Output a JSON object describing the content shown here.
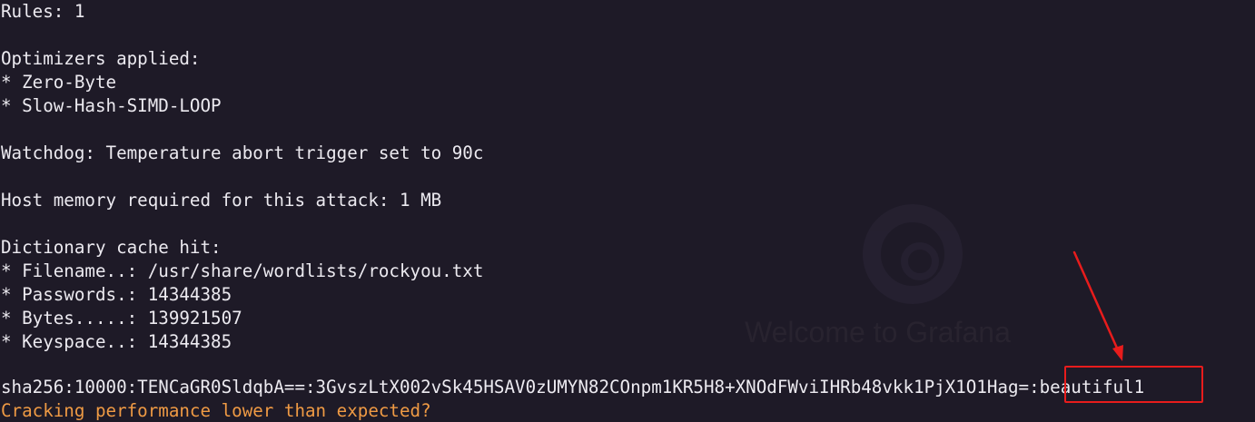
{
  "terminal": {
    "watermark": {
      "welcome_text": "Welcome to Grafana"
    },
    "lines": [
      {
        "text": "Rules: 1"
      },
      {
        "text": ""
      },
      {
        "text": "Optimizers applied:"
      },
      {
        "text": "* Zero-Byte"
      },
      {
        "text": "* Slow-Hash-SIMD-LOOP"
      },
      {
        "text": ""
      },
      {
        "text": "Watchdog: Temperature abort trigger set to 90c"
      },
      {
        "text": ""
      },
      {
        "text": "Host memory required for this attack: 1 MB"
      },
      {
        "text": ""
      },
      {
        "text": "Dictionary cache hit:"
      },
      {
        "text": "* Filename..: /usr/share/wordlists/rockyou.txt"
      },
      {
        "text": "* Passwords.: 14344385"
      },
      {
        "text": "* Bytes.....: 139921507"
      },
      {
        "text": "* Keyspace..: 14344385"
      },
      {
        "text": ""
      },
      {
        "text": "sha256:10000:TENCaGR0SldqbA==:3GvszLtX002vSk45HSAV0zUMYN82COnpm1KR5H8+XNOdFWviIHRb48vkk1PjX1O1Hag=:beautiful1"
      },
      {
        "text": "Cracking performance lower than expected?"
      }
    ]
  },
  "colors": {
    "background": "#1e1a27",
    "text": "#eceaf0",
    "warning": "#ef9a44",
    "annotation": "#e81c1c"
  }
}
